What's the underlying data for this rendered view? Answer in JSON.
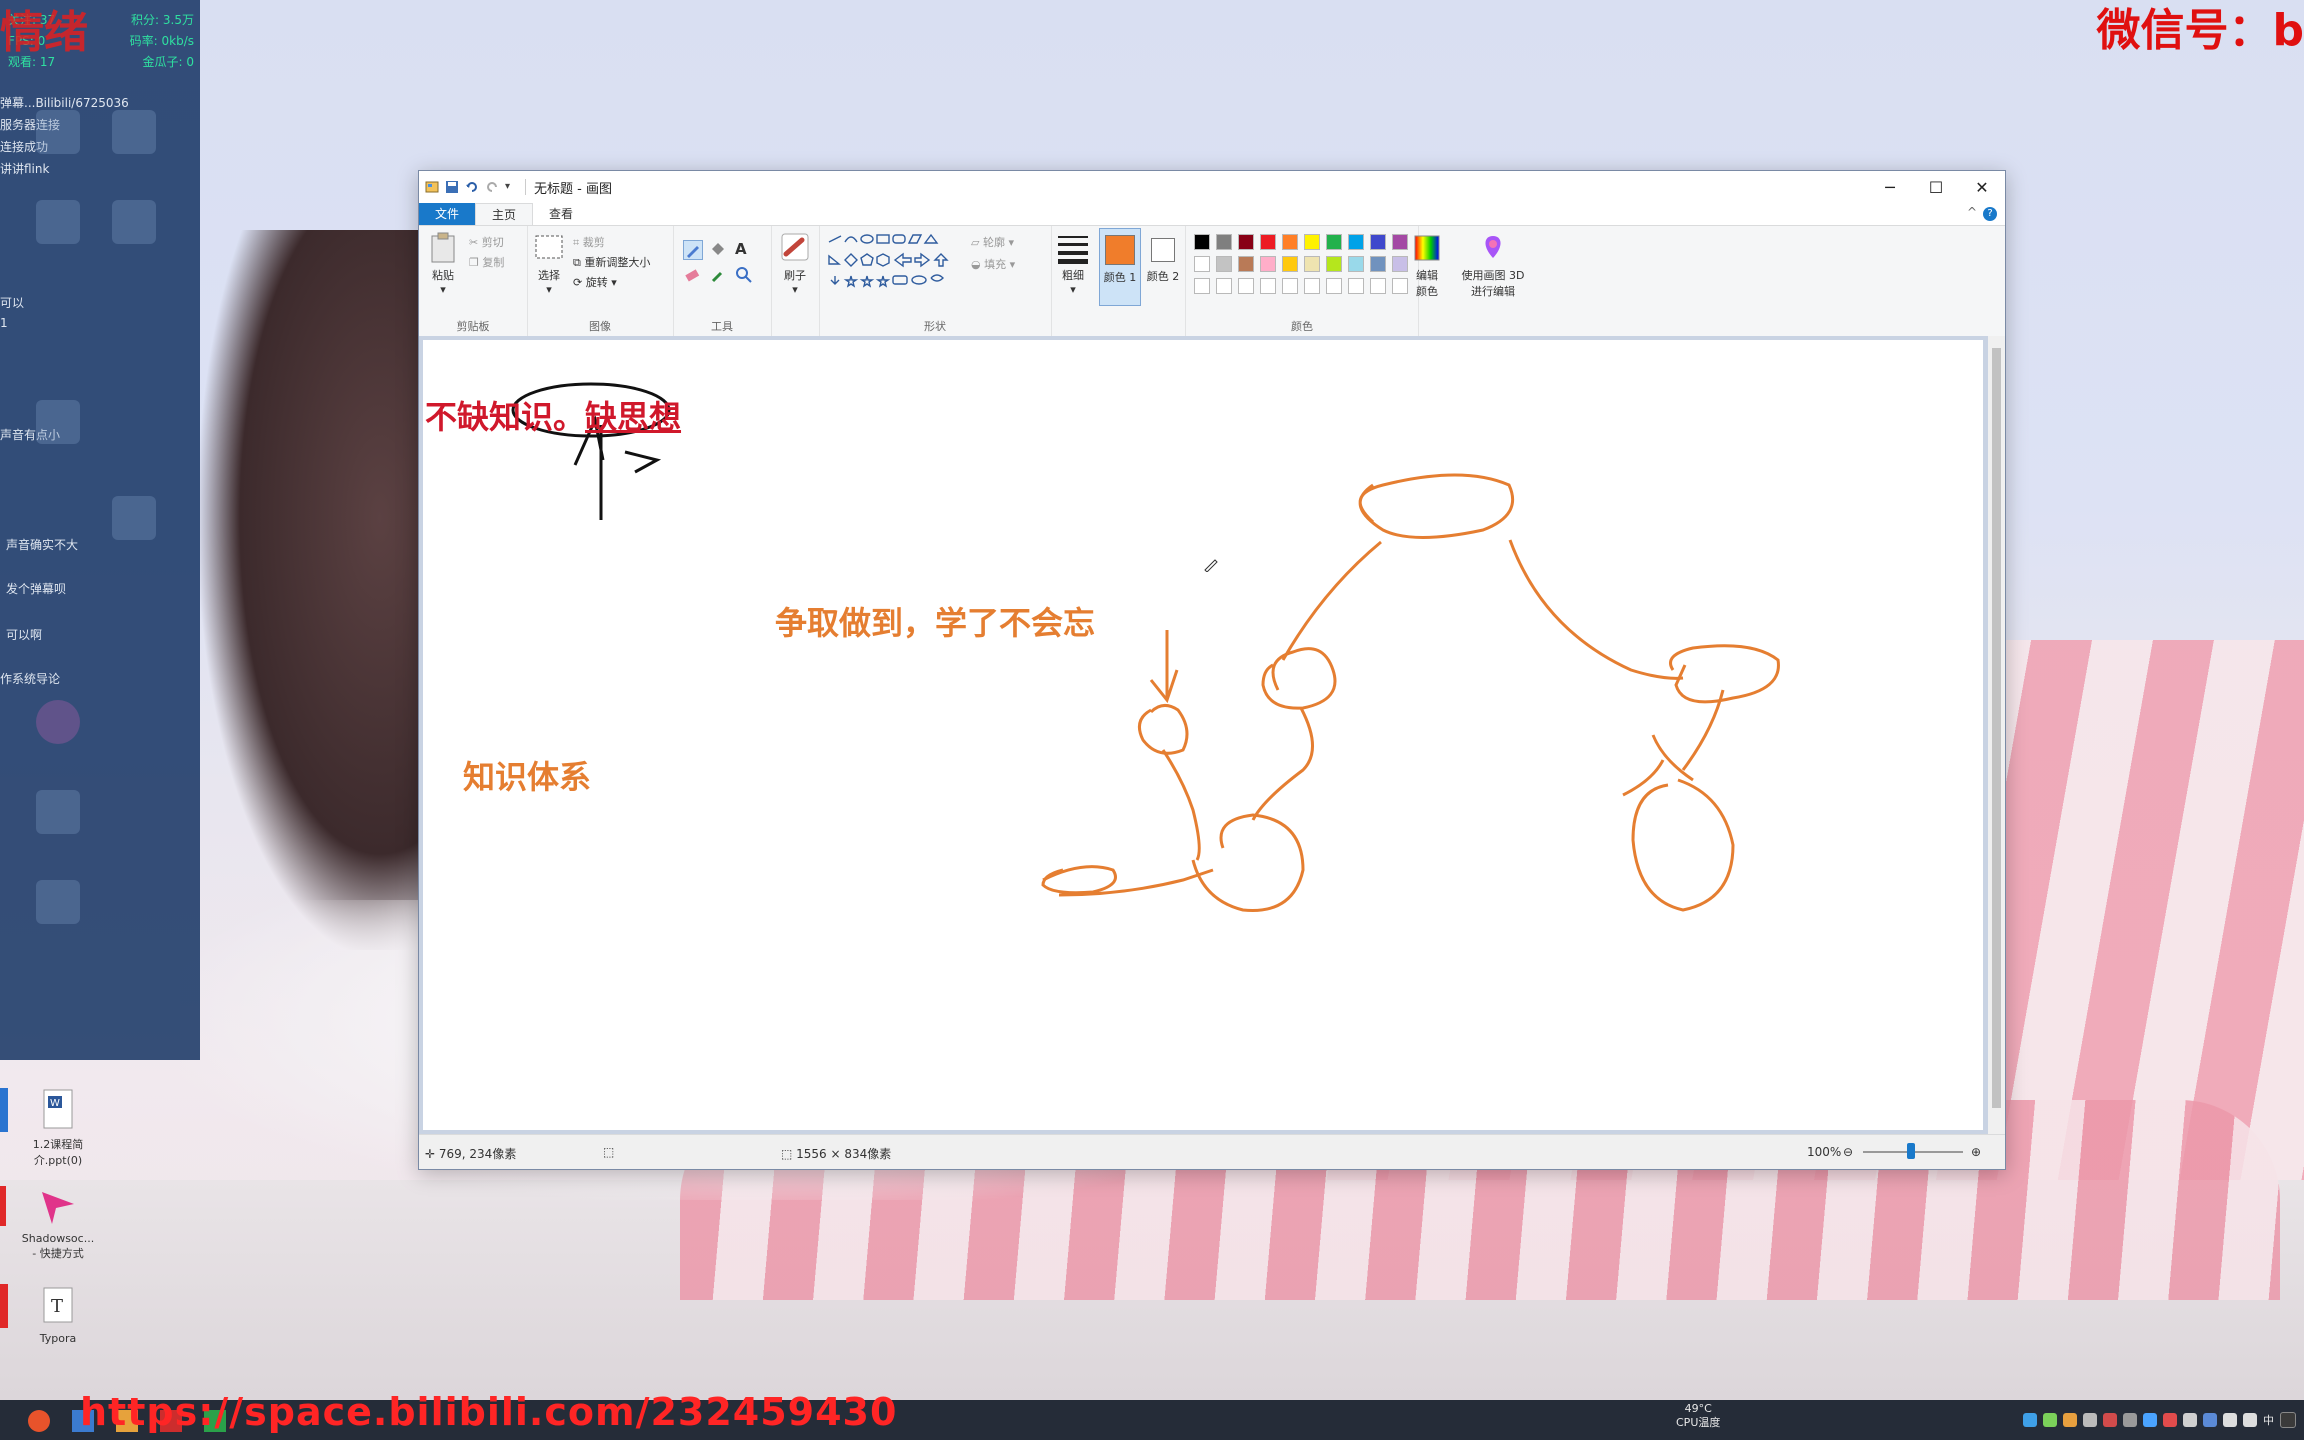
{
  "watermarks": {
    "top_left": "情绪",
    "top_right": "微信号：b",
    "bottom_url": "https://space.bilibili.com/232459430"
  },
  "overlay": {
    "stats": [
      [
        "关注: 37",
        "积分: 3.5万"
      ],
      [
        "FPS: 0",
        "码率: 0kb/s"
      ],
      [
        "观看: 17",
        "金瓜子: 0"
      ]
    ],
    "messages": [
      "弹幕...Bilibili/6725036",
      "服务器连接",
      "连接成功",
      "讲讲flink",
      "可以",
      "1",
      "声音有点小",
      "声音确实不大",
      "发个弹幕呗",
      "可以啊",
      "作系统导论"
    ]
  },
  "desktop_icons": [
    {
      "label": "1.2课程简介.ppt(0)"
    },
    {
      "label": "Shadowsoc... - 快捷方式"
    },
    {
      "label": "Typora"
    }
  ],
  "paint": {
    "title": "无标题 - 画图",
    "tabs": [
      "文件",
      "主页",
      "查看"
    ],
    "active_tab": "主页",
    "ribbon": {
      "clipboard": {
        "paste": "粘贴",
        "cut": "剪切",
        "copy": "复制",
        "group": "剪贴板"
      },
      "image": {
        "select": "选择",
        "crop": "裁剪",
        "resize": "重新调整大小",
        "rotate": "旋转",
        "group": "图像"
      },
      "tools": {
        "group": "工具"
      },
      "brushes": {
        "label": "刷子"
      },
      "shapes": {
        "outline": "轮廓",
        "fill": "填充",
        "group": "形状"
      },
      "size": {
        "label": "粗细"
      },
      "color1": {
        "label": "颜色 1",
        "value": "#f07d2b"
      },
      "color2": {
        "label": "颜色 2",
        "value": "#ffffff"
      },
      "colors": {
        "group": "颜色"
      },
      "edit_colors": {
        "label": "编辑颜色"
      },
      "paint3d": {
        "label": "使用画图 3D 进行编辑"
      },
      "palette": [
        "#000000",
        "#7f7f7f",
        "#880015",
        "#ed1c24",
        "#ff7f27",
        "#fff200",
        "#22b14c",
        "#00a2e8",
        "#3f48cc",
        "#a349a4",
        "#ffffff",
        "#c3c3c3",
        "#b97a57",
        "#ffaec9",
        "#ffc90e",
        "#efe4b0",
        "#b5e61d",
        "#99d9ea",
        "#7092be",
        "#c8bfe7"
      ]
    },
    "canvas_text": {
      "t1_part1": "不缺知识。",
      "t1_part2": "缺思想",
      "t2": "争取做到，学了不会忘",
      "t3": "知识体系"
    },
    "status": {
      "cursor_pos": "769, 234像素",
      "canvas_size": "1556 × 834像素",
      "zoom": "100%"
    }
  },
  "taskbar": {
    "cpu_temp": "49°C",
    "cpu_label": "CPU温度",
    "ime": "中"
  }
}
